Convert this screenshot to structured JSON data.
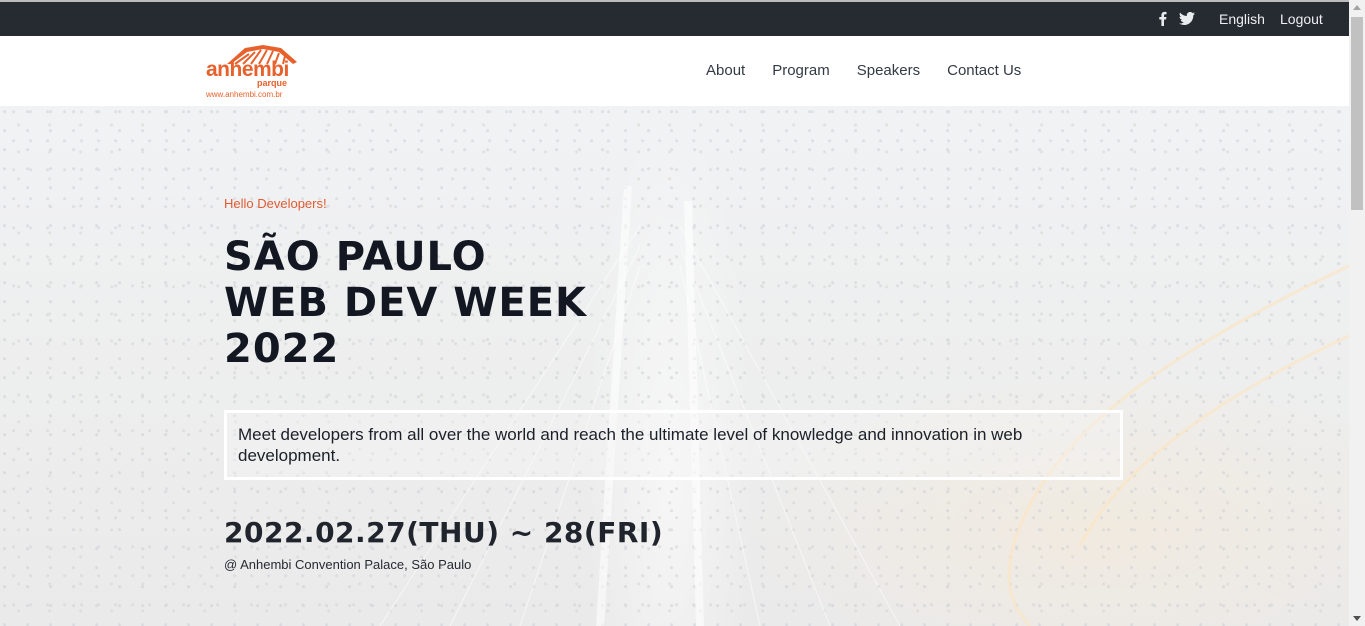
{
  "topbar": {
    "social": [
      "facebook-icon",
      "twitter-icon"
    ],
    "language": "English",
    "logout": "Logout"
  },
  "header": {
    "logo": {
      "brand": "anhembi",
      "sub": "parque",
      "url": "www.anhembi.com.br"
    },
    "nav": [
      "About",
      "Program",
      "Speakers",
      "Contact Us"
    ]
  },
  "hero": {
    "greeting": "Hello Developers!",
    "title_lines": [
      "SÃO PAULO",
      "WEB DEV WEEK",
      "2022"
    ],
    "description": "Meet developers from all over the world and reach the ultimate level of knowledge and innovation in web development.",
    "date": "2022.02.27(THU) ~ 28(FRI)",
    "venue": "@ Anhembi Convention Palace, São Paulo"
  },
  "colors": {
    "accent": "#e8612c",
    "topbar_bg": "#262a31",
    "text_dark": "#121722"
  }
}
